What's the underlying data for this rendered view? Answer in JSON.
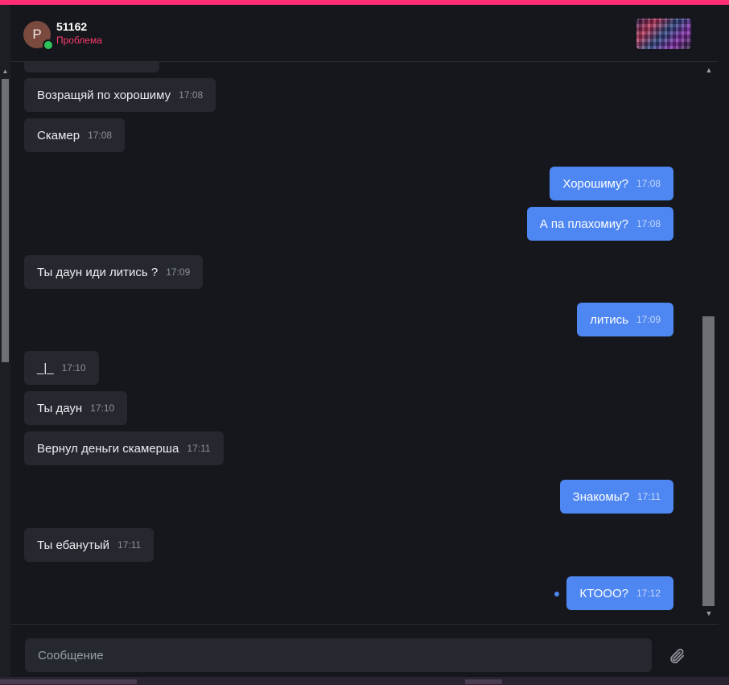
{
  "header": {
    "avatar_letter": "P",
    "username": "51162",
    "status": "Проблема"
  },
  "messages": [
    {
      "side": "in",
      "text": "",
      "time": ""
    },
    {
      "side": "in",
      "text": "Возращяй по хорошиму",
      "time": "17:08"
    },
    {
      "side": "in",
      "text": "Скамер",
      "time": "17:08"
    },
    {
      "side": "out",
      "text": "Хорошиму?",
      "time": "17:08"
    },
    {
      "side": "out",
      "text": "А па плахомиу?",
      "time": "17:08"
    },
    {
      "side": "in",
      "text": "Ты даун иди литись ?",
      "time": "17:09"
    },
    {
      "side": "out",
      "text": "литись",
      "time": "17:09"
    },
    {
      "side": "in",
      "text": "_|_",
      "time": "17:10"
    },
    {
      "side": "in",
      "text": "Ты даун",
      "time": "17:10"
    },
    {
      "side": "in",
      "text": "Вернул деньги скамерша",
      "time": "17:11"
    },
    {
      "side": "out",
      "text": "Знакомы?",
      "time": "17:11"
    },
    {
      "side": "in",
      "text": "Ты ебанутый",
      "time": "17:11"
    },
    {
      "side": "out",
      "text": "КТООО?",
      "time": "17:12"
    }
  ],
  "composer": {
    "placeholder": "Сообщение"
  },
  "icons": {
    "attach": "paperclip-icon",
    "online": "online-status-dot",
    "scroll_up": "arrow-up-icon",
    "scroll_down": "arrow-down-icon"
  },
  "colors": {
    "accent_bar": "#ff2d75",
    "status_text": "#ff3d6e",
    "outgoing_bubble": "#4f87f2",
    "incoming_bubble": "#262830",
    "background": "#15171c",
    "online": "#2fc15b"
  }
}
